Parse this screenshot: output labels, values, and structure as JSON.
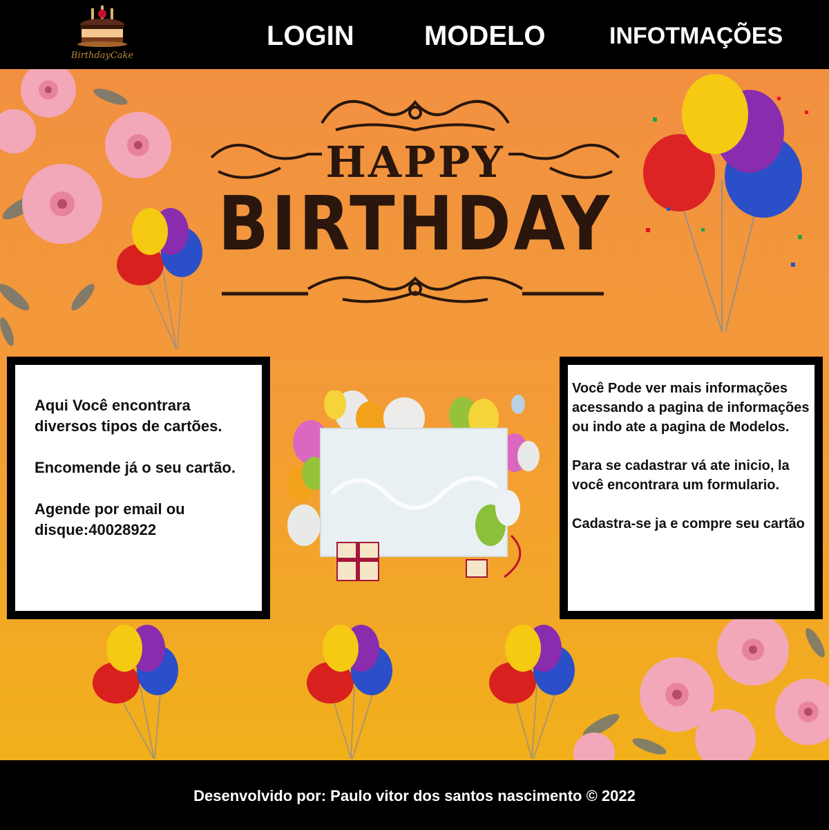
{
  "header": {
    "logo": {
      "text": "BirthdayCake",
      "icon": "birthday-cake-icon"
    },
    "nav": [
      {
        "label": "LOGIN"
      },
      {
        "label": "MODELO"
      },
      {
        "label": "INFOTMAÇÕES"
      }
    ]
  },
  "hero": {
    "title_line1": "HAPPY",
    "title_line2": "BIRTHDAY"
  },
  "left_box": {
    "paragraphs": [
      "Aqui Você encontrara diversos tipos de cartões.",
      "Encomende já o seu cartão.",
      "Agende por email ou disque:40028922"
    ]
  },
  "right_box": {
    "paragraphs": [
      "Você Pode ver mais informações acessando a pagina de informações ou indo ate a pagina de Modelos.",
      "Para se cadastrar vá ate inicio, la você encontrara um formulario.",
      "Cadastra-se ja e compre seu cartão"
    ]
  },
  "footer": {
    "text": "Desenvolvido por: Paulo vitor dos santos nascimento © 2022"
  },
  "colors": {
    "background_top": "#f29041",
    "background_bottom": "#f2b01a",
    "bar": "#000000",
    "title": "#2a160c"
  }
}
